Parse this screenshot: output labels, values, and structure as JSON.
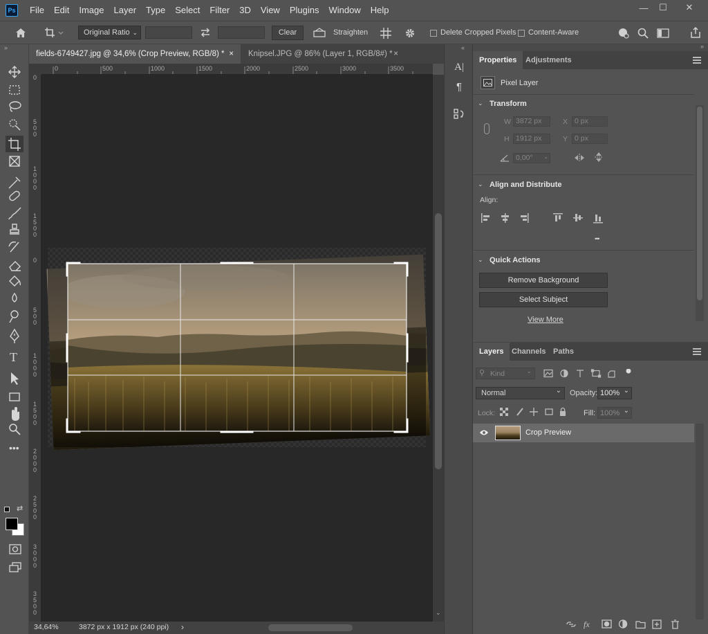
{
  "menu": [
    "File",
    "Edit",
    "Image",
    "Layer",
    "Type",
    "Select",
    "Filter",
    "3D",
    "View",
    "Plugins",
    "Window",
    "Help"
  ],
  "app_logo": "Ps",
  "window_controls": {
    "minimize": "—",
    "maximize": "☐",
    "close": "✕"
  },
  "options": {
    "ratio": "Original Ratio",
    "clear": "Clear",
    "straighten": "Straighten",
    "delete_cropped": "Delete Cropped Pixels",
    "content_aware": "Content-Aware"
  },
  "tabs": [
    {
      "label": "fields-6749427.jpg @ 34,6% (Crop Preview, RGB/8) *",
      "close": "×"
    },
    {
      "label": "Knipsel.JPG @ 86% (Layer 1, RGB/8#) *",
      "close": "×"
    }
  ],
  "ruler": {
    "top": [
      "0",
      "500",
      "1000",
      "1500",
      "2000",
      "2500",
      "3000",
      "3500"
    ],
    "left": [
      "0",
      "500",
      "1000",
      "1500",
      "0",
      "500",
      "1000",
      "1500",
      "2000",
      "2500",
      "3000",
      "3500"
    ]
  },
  "status": {
    "zoom": "34,64%",
    "info": "3872 px x 1912 px (240 ppi)",
    "arrow": "›"
  },
  "properties": {
    "tab_props": "Properties",
    "tab_adjust": "Adjustments",
    "pixel_layer": "Pixel Layer",
    "transform": "Transform",
    "w_label": "W",
    "w": "3872 px",
    "h_label": "H",
    "h": "1912 px",
    "x_label": "X",
    "x": "0 px",
    "y_label": "Y",
    "y": "0 px",
    "angle": "0,00°",
    "align_distribute": "Align and Distribute",
    "align": "Align:",
    "quick_actions": "Quick Actions",
    "remove_bg": "Remove Background",
    "select_subject": "Select Subject",
    "view_more": "View More",
    "more_dots": "•••"
  },
  "layers": {
    "tab_layers": "Layers",
    "tab_channels": "Channels",
    "tab_paths": "Paths",
    "kind": "Kind",
    "blend": "Normal",
    "opacity_label": "Opacity:",
    "opacity": "100%",
    "lock_label": "Lock:",
    "fill_label": "Fill:",
    "fill": "100%",
    "layer_name": "Crop Preview"
  },
  "colors": {
    "accent": "#31a8ff",
    "panel": "#535353",
    "canvas": "#282828"
  }
}
